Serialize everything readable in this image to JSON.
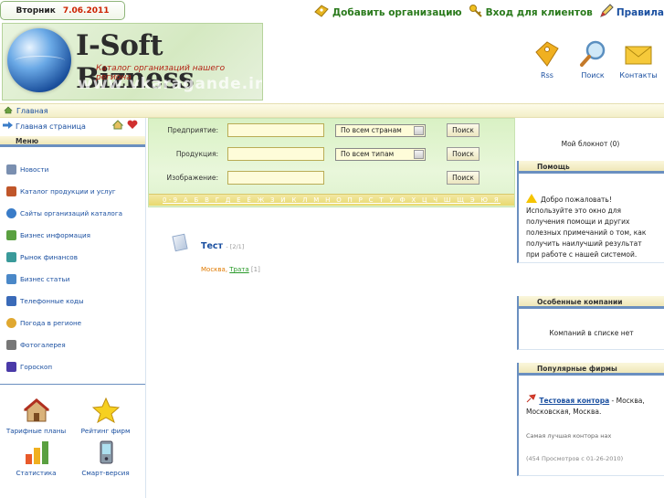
{
  "topbar": {
    "day": "Вторник",
    "date": "7.06.2011",
    "links": [
      {
        "label": "Добавить организацию",
        "icon": "key-tag-icon"
      },
      {
        "label": "Вход для клиентов",
        "icon": "key-icon"
      },
      {
        "label": "Правила",
        "icon": "pencil-icon"
      }
    ]
  },
  "logo": {
    "brand": "I-Soft Bizness",
    "tagline": "Каталог организаций нашего региона",
    "domain": "www.vkaragande.info"
  },
  "header_icons": [
    {
      "label": "Rss",
      "icon": "rss-tag-icon"
    },
    {
      "label": "Поиск",
      "icon": "magnifier-icon"
    },
    {
      "label": "Контакты",
      "icon": "envelope-icon"
    }
  ],
  "breadcrumb": {
    "label": "Главная"
  },
  "sidebar": {
    "home_label": "Главная страница",
    "menu_title": "Меню",
    "items": [
      {
        "label": "Новости",
        "icon": "news-icon",
        "color": "#7a8fb0"
      },
      {
        "label": "Каталог продукции и услуг",
        "icon": "catalog-icon",
        "color": "#c0562a"
      },
      {
        "label": "Сайты организаций каталога",
        "icon": "globe-icon",
        "color": "#3a7cc8"
      },
      {
        "label": "Бизнес информация",
        "icon": "money-icon",
        "color": "#5aa040"
      },
      {
        "label": "Рынок финансов",
        "icon": "finance-icon",
        "color": "#3a9a9a"
      },
      {
        "label": "Бизнес статьи",
        "icon": "articles-icon",
        "color": "#4a88c8"
      },
      {
        "label": "Телефонные коды",
        "icon": "phone-book-icon",
        "color": "#3a6ab8"
      },
      {
        "label": "Погода в регионе",
        "icon": "weather-icon",
        "color": "#e0a830"
      },
      {
        "label": "Фотогалерея",
        "icon": "camera-icon",
        "color": "#777777"
      },
      {
        "label": "Гороскоп",
        "icon": "zodiac-icon",
        "color": "#4a3aa8"
      }
    ],
    "bottom": [
      {
        "label": "Тарифные планы",
        "icon": "house-icon"
      },
      {
        "label": "Рейтинг фирм",
        "icon": "star-icon"
      },
      {
        "label": "Статистика",
        "icon": "bar-chart-icon"
      },
      {
        "label": "Смарт-версия",
        "icon": "smartphone-icon"
      }
    ]
  },
  "search": {
    "rows": [
      {
        "label": "Предприятие:",
        "value": "",
        "select": "По всем странам",
        "button": "Поиск"
      },
      {
        "label": "Продукция:",
        "value": "",
        "select": "По всем типам",
        "button": "Поиск"
      },
      {
        "label": "Изображение:",
        "value": "",
        "select": "",
        "button": "Поиск"
      }
    ],
    "alphabet": "0-9 А Б В Г Д Е Ё Ж З И К Л М Н О П Р С Т У Ф Х Ц Ч Ш Щ Э Ю Я"
  },
  "result": {
    "title": "Тест",
    "count": "- [2/1]",
    "city": "Москва,",
    "category": "Трата",
    "category_count": "[1]"
  },
  "right": {
    "notebook": "Мой блокнот (0)",
    "help_title": "Помощь",
    "help_text": "Добро пожаловать! Используйте это окно для получения помощи и других полезных примечаний о том, как получить наилучший результат при работе с нашей системой.",
    "special_title": "Особенные компании",
    "special_text": "Компаний в списке нет",
    "popular_title": "Популярные фирмы",
    "popular_firm": "Тестовая контора",
    "popular_location": "- Москва, Московская, Москва.",
    "popular_desc": "Самая лучшая контора нах",
    "popular_views": "(454 Просмотров с 01-26-2010)"
  }
}
